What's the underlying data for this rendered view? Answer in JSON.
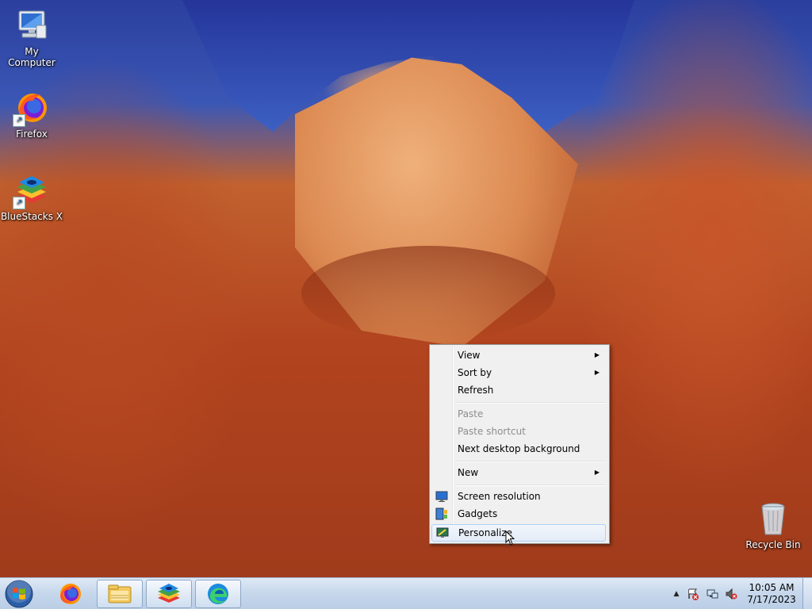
{
  "desktop": {
    "icons": [
      {
        "label": "My Computer"
      },
      {
        "label": "Firefox"
      },
      {
        "label": "BlueStacks X"
      },
      {
        "label": "Recycle Bin"
      }
    ]
  },
  "context_menu": {
    "items": [
      {
        "label": "View",
        "submenu": true,
        "enabled": true
      },
      {
        "label": "Sort by",
        "submenu": true,
        "enabled": true
      },
      {
        "label": "Refresh",
        "enabled": true
      },
      {
        "label": "Paste",
        "enabled": false
      },
      {
        "label": "Paste shortcut",
        "enabled": false
      },
      {
        "label": "Next desktop background",
        "enabled": true
      },
      {
        "label": "New",
        "submenu": true,
        "enabled": true
      },
      {
        "label": "Screen resolution",
        "icon": "monitor-icon",
        "enabled": true
      },
      {
        "label": "Gadgets",
        "icon": "gadgets-icon",
        "enabled": true
      },
      {
        "label": "Personalize",
        "icon": "personalize-icon",
        "enabled": true,
        "highlighted": true
      }
    ],
    "submenu_arrow": "▶"
  },
  "taskbar": {
    "buttons": [
      {
        "name": "start-button",
        "icon": "windows-logo-icon"
      },
      {
        "name": "firefox",
        "icon": "firefox-icon"
      },
      {
        "name": "file-explorer",
        "icon": "folder-icon"
      },
      {
        "name": "bluestacks",
        "icon": "bluestacks-icon"
      },
      {
        "name": "edge",
        "icon": "edge-icon"
      }
    ],
    "tray": {
      "show_hidden": "▲",
      "icons": [
        "action-center-icon",
        "network-icon",
        "volume-muted-icon"
      ]
    },
    "clock": {
      "time": "10:05 AM",
      "date": "7/17/2023"
    }
  }
}
